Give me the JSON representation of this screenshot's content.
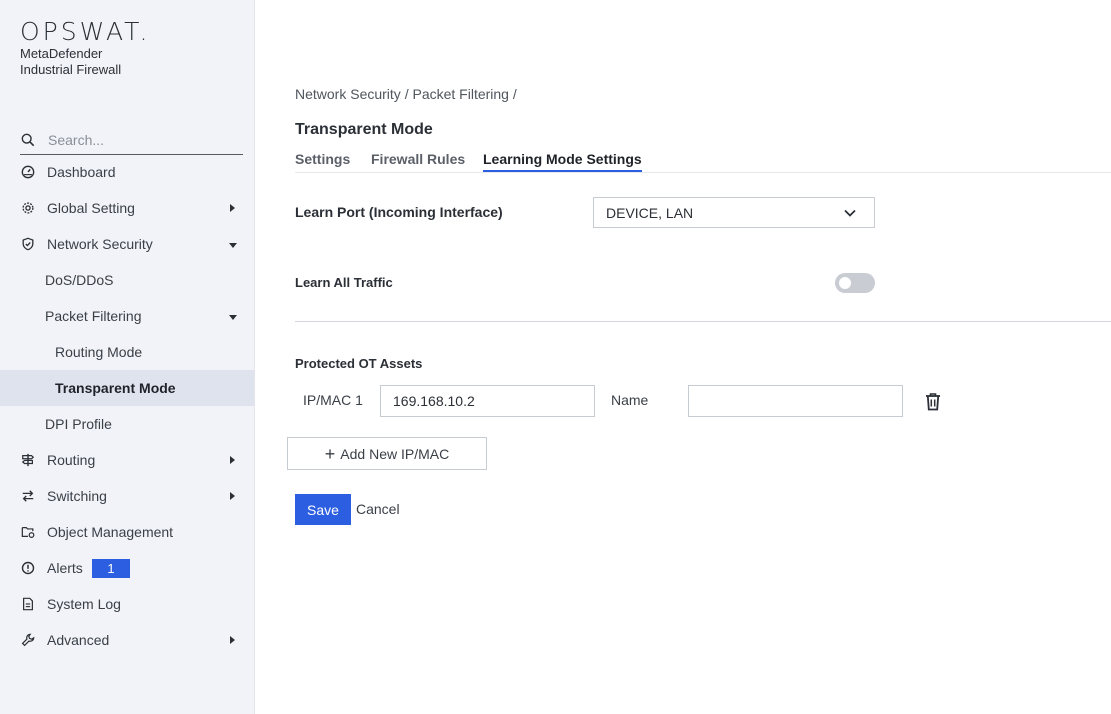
{
  "brand": {
    "logo": "OPSWAT.",
    "product_line1": "MetaDefender",
    "product_line2": "Industrial Firewall"
  },
  "search": {
    "placeholder": "Search..."
  },
  "sidebar": {
    "items": [
      {
        "label": "Dashboard",
        "icon": "dashboard-icon"
      },
      {
        "label": "Global Setting",
        "icon": "gear-icon",
        "caret": "right"
      },
      {
        "label": "Network Security",
        "icon": "shield-icon",
        "caret": "down"
      },
      {
        "label": "DoS/DDoS"
      },
      {
        "label": "Packet Filtering",
        "caret": "down"
      },
      {
        "label": "Routing Mode"
      },
      {
        "label": "Transparent Mode",
        "active": true
      },
      {
        "label": "DPI Profile"
      },
      {
        "label": "Routing",
        "icon": "signpost-icon",
        "caret": "right"
      },
      {
        "label": "Switching",
        "icon": "switch-arrows-icon",
        "caret": "right"
      },
      {
        "label": "Object Management",
        "icon": "folder-gear-icon"
      },
      {
        "label": "Alerts",
        "icon": "alert-circle-icon",
        "badge": "1"
      },
      {
        "label": "System Log",
        "icon": "log-file-icon"
      },
      {
        "label": "Advanced",
        "icon": "wrench-icon",
        "caret": "right"
      }
    ]
  },
  "main": {
    "breadcrumb": "Network Security / Packet Filtering /",
    "title": "Transparent Mode",
    "tabs": [
      {
        "label": "Settings"
      },
      {
        "label": "Firewall Rules"
      },
      {
        "label": "Learning Mode Settings",
        "active": true
      }
    ],
    "learn_port": {
      "label": "Learn Port (Incoming Interface)",
      "value": "DEVICE, LAN"
    },
    "learn_all_traffic": {
      "label": "Learn All Traffic",
      "enabled": false
    },
    "protected_assets": {
      "heading": "Protected OT Assets",
      "rows": [
        {
          "ip_label": "IP/MAC 1",
          "ip_value": "169.168.10.2",
          "name_label": "Name",
          "name_value": ""
        }
      ],
      "add_label": "Add New IP/MAC"
    },
    "actions": {
      "save_label": "Save",
      "cancel_label": "Cancel"
    }
  },
  "colors": {
    "accent": "#2b5ee0",
    "sidebar_bg": "#f1f3f8",
    "active_bg": "#dfe3ee"
  }
}
